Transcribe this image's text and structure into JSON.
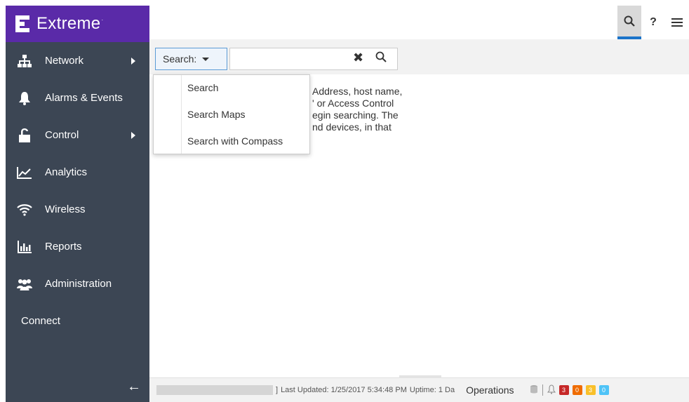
{
  "app": {
    "brand": "Extreme",
    "trademark": "·"
  },
  "sidebar": {
    "items": [
      {
        "label": "Network",
        "icon": "network-tree-icon",
        "submenu": true
      },
      {
        "label": "Alarms & Events",
        "icon": "bell-icon",
        "submenu": false
      },
      {
        "label": "Control",
        "icon": "lock-icon",
        "submenu": true
      },
      {
        "label": "Analytics",
        "icon": "line-chart-icon",
        "submenu": false
      },
      {
        "label": "Wireless",
        "icon": "wifi-icon",
        "submenu": false
      },
      {
        "label": "Reports",
        "icon": "bar-report-icon",
        "submenu": false
      },
      {
        "label": "Administration",
        "icon": "users-icon",
        "submenu": false
      },
      {
        "label": "Connect",
        "icon": "",
        "submenu": false
      }
    ],
    "collapse_glyph": "←"
  },
  "toolbar": {
    "help_label": "?"
  },
  "search": {
    "type_label": "Search:",
    "input_value": "",
    "clear_glyph": "✖",
    "menu": [
      "Search",
      "Search Maps",
      "Search with Compass"
    ]
  },
  "help_text": {
    "lines": [
      "Address, host name,",
      "' or Access Control",
      "egin searching. The",
      "nd devices, in that"
    ]
  },
  "status": {
    "prefix": "]",
    "last_updated": "Last Updated: 1/25/2017 5:34:48 PM",
    "uptime": "Uptime: 1 Da",
    "operations": "Operations",
    "badges": [
      {
        "value": "3",
        "color": "#c62828"
      },
      {
        "value": "0",
        "color": "#ef6c00"
      },
      {
        "value": "3",
        "color": "#f9c02a"
      },
      {
        "value": "0",
        "color": "#4fc3f7"
      }
    ]
  },
  "colors": {
    "brand": "#5a2aa8",
    "sidebar": "#3c4654",
    "accent": "#1a73c9"
  }
}
